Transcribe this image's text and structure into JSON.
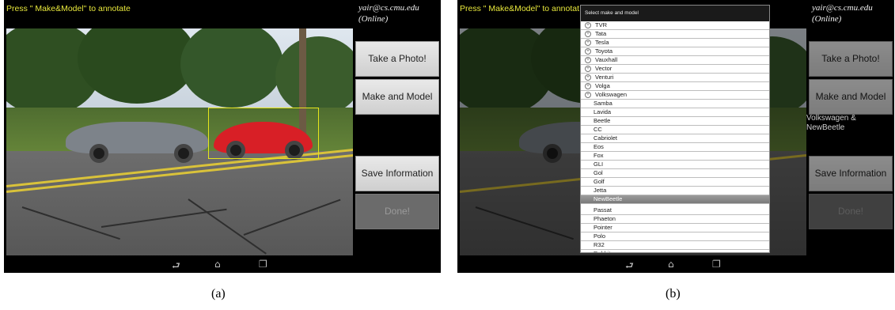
{
  "panel_a": {
    "hint": "Press \" Make&Model\" to annotate",
    "account": {
      "email": "yair@cs.cmu.edu",
      "status": "(Online)"
    },
    "buttons": {
      "take_photo": "Take a Photo!",
      "make_model": "Make and Model",
      "save_info": "Save Information",
      "done": "Done!"
    },
    "caption": "(a)"
  },
  "panel_b": {
    "hint": "Press \" Make&Model\" to annotat",
    "account": {
      "email": "yair@cs.cmu.edu",
      "status": "(Online)"
    },
    "buttons": {
      "take_photo": "Take a Photo!",
      "make_model": "Make and Model",
      "save_info": "Save Information",
      "done": "Done!"
    },
    "selection_line1": "Volkswagen &",
    "selection_line2": "NewBeetle",
    "caption": "(b)",
    "dialog": {
      "title": "Select make and model",
      "brands": [
        "TVR",
        "Tata",
        "Tesla",
        "Toyota",
        "Vauxhall",
        "Vector",
        "Venturi",
        "Volga",
        "Volkswagen"
      ],
      "models": [
        "Samba",
        "Lavida",
        "Beetle",
        "CC",
        "Cabriolet",
        "Eos",
        "Fox",
        "GLI",
        "Gol",
        "Golf",
        "Jetta",
        "NewBeetle",
        "Passat",
        "Phaeton",
        "Pointer",
        "Polo",
        "R32",
        "Rabbit"
      ],
      "selected_model": "NewBeetle"
    }
  },
  "nav_icons": [
    "back-icon",
    "home-icon",
    "recent-apps-icon"
  ],
  "colors": {
    "hint_text": "#e8e83c",
    "bbox": "#e6e61c",
    "red_car": "#d81f26",
    "gray_car": "#7d838a"
  }
}
